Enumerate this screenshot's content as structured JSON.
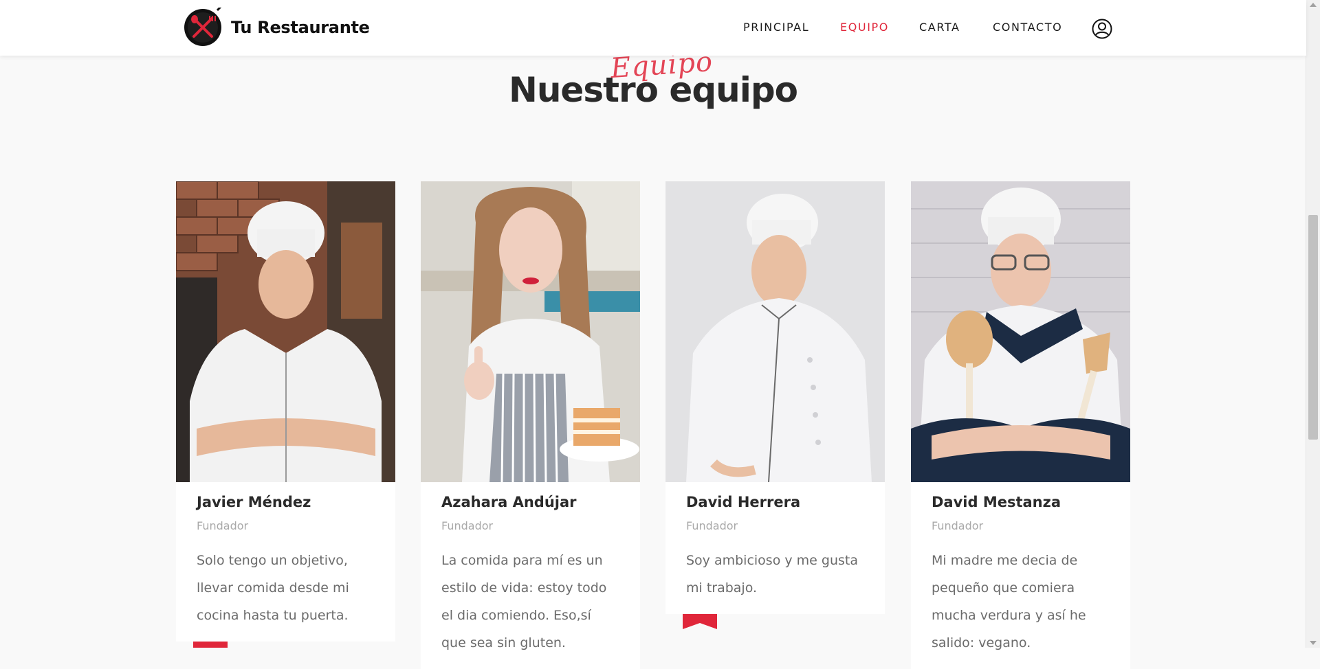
{
  "header": {
    "brand": "Tu Restaurante",
    "nav": [
      {
        "label": "PRINCIPAL",
        "active": false
      },
      {
        "label": "EQUIPO",
        "active": true
      },
      {
        "label": "CARTA",
        "active": false
      },
      {
        "label": "CONTACTO",
        "active": false
      }
    ]
  },
  "section": {
    "script_title": "Equipo",
    "title": "Nuestro equipo"
  },
  "team": [
    {
      "name": "Javier Méndez",
      "role": "Fundador",
      "description": "Solo tengo un objetivo, llevar comida desde mi cocina hasta tu puerta."
    },
    {
      "name": "Azahara Andújar",
      "role": "Fundador",
      "description": "La comida para mí es un estilo de vida: estoy todo el dia comiendo. Eso,sí que sea sin gluten."
    },
    {
      "name": "David Herrera",
      "role": "Fundador",
      "description": "Soy ambicioso y me gusta mi trabajo."
    },
    {
      "name": "David Mestanza",
      "role": "Fundador",
      "description": "Mi madre me decia de pequeño que comiera mucha verdura y así he salido: vegano."
    }
  ],
  "colors": {
    "accent": "#e0263a",
    "text_dark": "#2a2a2a",
    "text_muted": "#6b6b6b",
    "background": "#f9f9f9"
  }
}
